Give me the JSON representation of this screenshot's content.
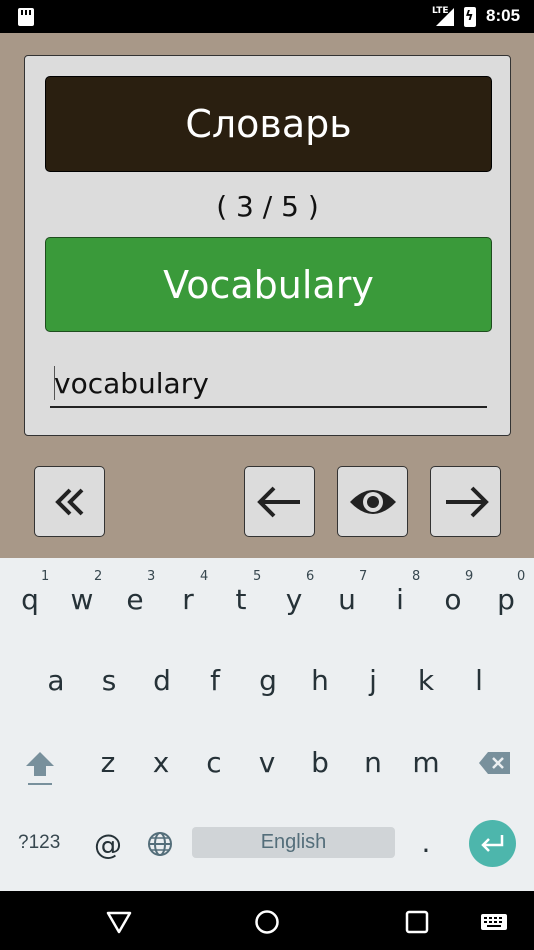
{
  "status_bar": {
    "network": "LTE",
    "time": "8:05"
  },
  "app": {
    "word": "Словарь",
    "counter": "( 3 / 5 )",
    "answer": "Vocabulary",
    "input_value": "vocabulary",
    "buttons": {
      "first": "first-page-icon",
      "previous": "arrow-left-icon",
      "reveal": "eye-icon",
      "next": "arrow-right-icon"
    }
  },
  "keyboard": {
    "row1": [
      "q",
      "w",
      "e",
      "r",
      "t",
      "y",
      "u",
      "i",
      "o",
      "p"
    ],
    "row1_hints": [
      "1",
      "2",
      "3",
      "4",
      "5",
      "6",
      "7",
      "8",
      "9",
      "0"
    ],
    "row2": [
      "a",
      "s",
      "d",
      "f",
      "g",
      "h",
      "j",
      "k",
      "l"
    ],
    "row3": [
      "z",
      "x",
      "c",
      "v",
      "b",
      "n",
      "m"
    ],
    "symbols": "?123",
    "at": "@",
    "space_label": "English",
    "period": "."
  },
  "colors": {
    "app_bg": "#a89888",
    "word_bg": "#2a1f10",
    "answer_bg": "#3a9a3a",
    "enter": "#4db6ac"
  }
}
